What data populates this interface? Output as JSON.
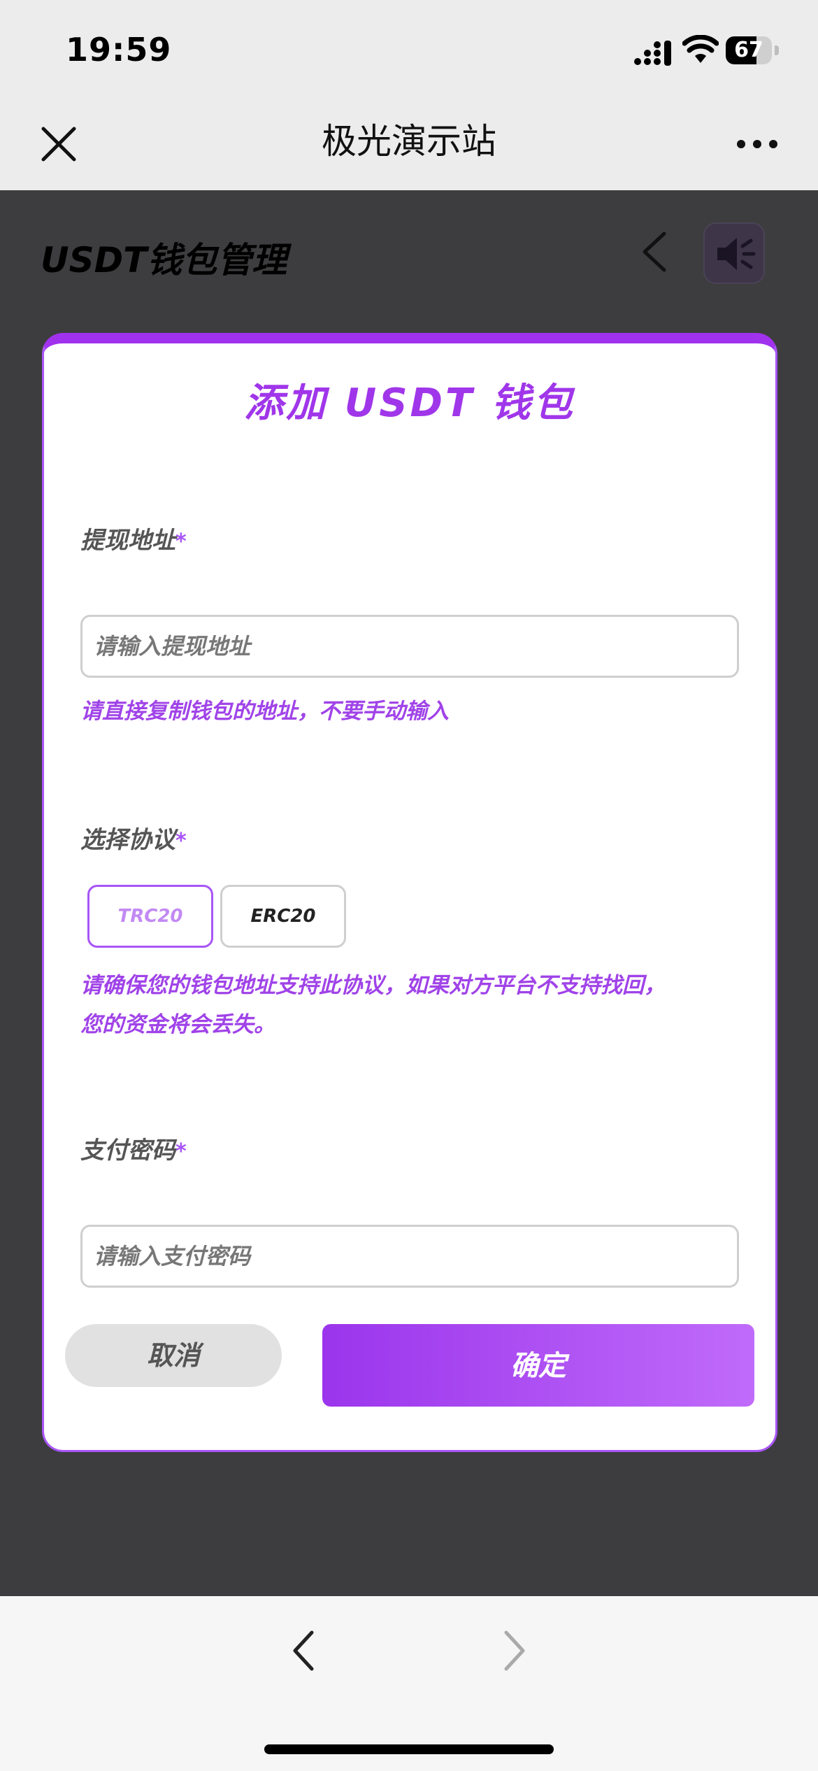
{
  "status_bar": {
    "time": "19:59",
    "battery": "67",
    "battery_level_percent": 67
  },
  "nav": {
    "title": "极光演示站",
    "close_icon": "close-icon",
    "more_icon": "more-dots-icon"
  },
  "page": {
    "title": "USDT钱包管理",
    "back_icon": "chevron-left-icon",
    "sound_icon": "speaker-icon"
  },
  "modal": {
    "title": "添加 USDT 钱包",
    "address": {
      "label": "提现地址",
      "required_mark": "*",
      "placeholder": "请输入提现地址",
      "hint": "请直接复制钱包的地址，不要手动输入"
    },
    "protocol": {
      "label": "选择协议",
      "required_mark": "*",
      "options": [
        "TRC20",
        "ERC20"
      ],
      "selected": "TRC20",
      "hint_line1": "请确保您的钱包地址支持此协议，如果对方平台不支持找回，",
      "hint_line2": "您的资金将会丢失。"
    },
    "password": {
      "label": "支付密码",
      "required_mark": "*",
      "placeholder": "请输入支付密码"
    },
    "cancel_label": "取消",
    "confirm_label": "确定"
  },
  "colors": {
    "accent": "#a855f7",
    "hint": "#a043e8",
    "overlay": "#3d3d3f"
  }
}
